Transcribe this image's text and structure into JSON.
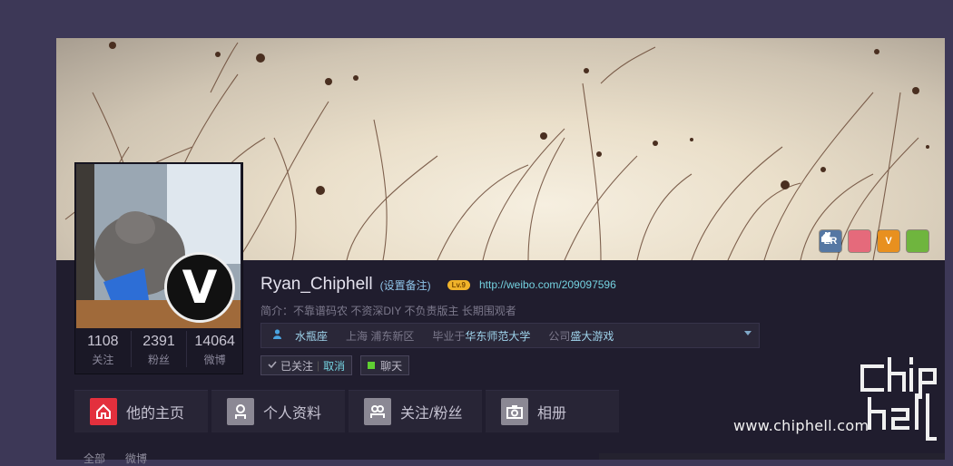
{
  "profile": {
    "name": "Ryan_Chiphell",
    "remark_link": "(设置备注)",
    "level_badge": "Lv.9",
    "url": "http://weibo.com/209097596",
    "bio": "简介：不靠谱码农 不资深DIY 不负责版主 长期围观者",
    "avatar_mark": "V"
  },
  "stats": [
    {
      "num": "1108",
      "label": "关注"
    },
    {
      "num": "2391",
      "label": "粉丝"
    },
    {
      "num": "14064",
      "label": "微博"
    }
  ],
  "info": {
    "zodiac": "水瓶座",
    "location": "上海 浦东新区",
    "edu_prefix": "毕业于",
    "school": "华东师范大学",
    "company_prefix": "公司",
    "company": "盛大游戏"
  },
  "actions": {
    "followed": "已关注",
    "separator": "|",
    "cancel": "取消",
    "chat": "聊天"
  },
  "badges": [
    {
      "text": "LR",
      "name": "lr-badge"
    },
    {
      "text": "",
      "name": "cake-badge"
    },
    {
      "text": "V",
      "name": "v-badge"
    },
    {
      "text": "",
      "name": "green-badge"
    }
  ],
  "tabs": [
    {
      "label": "他的主页",
      "icon": "home-icon"
    },
    {
      "label": "个人资料",
      "icon": "person-icon"
    },
    {
      "label": "关注/粉丝",
      "icon": "people-icon"
    },
    {
      "label": "相册",
      "icon": "camera-icon"
    }
  ],
  "subtabs": [
    "全部",
    "微博"
  ],
  "watermark": {
    "logo": "chip hell",
    "site": "www.chiphell.com"
  },
  "colors": {
    "page_bg": "#3d3857",
    "panel_bg": "#201d2e",
    "accent_red": "#e3303d",
    "link_cyan": "#74d2e0"
  }
}
